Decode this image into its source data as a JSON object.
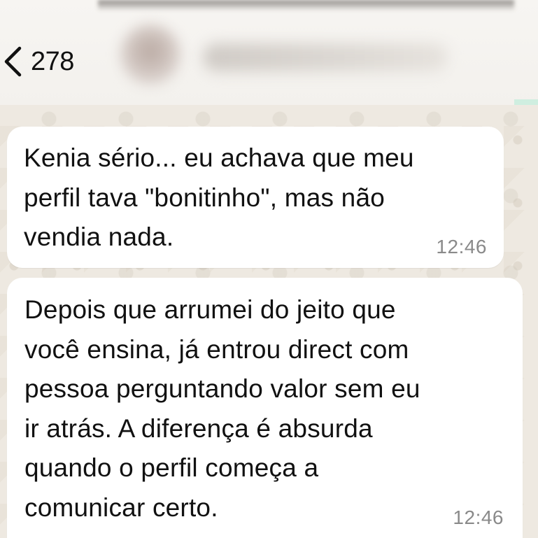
{
  "header": {
    "unread_count": "278",
    "back_icon": "chevron-left-icon"
  },
  "colors": {
    "chat_background": "#efeae2",
    "bubble_background": "#ffffff",
    "text": "#111111",
    "timestamp": "#8a8a8a"
  },
  "messages": [
    {
      "text": "Kenia sério... eu achava que meu\nperfil tava \"bonitinho\", mas não\nvendia nada.",
      "time": "12:46"
    },
    {
      "text": "Depois que arrumei do jeito que\nvocê ensina, já entrou direct com\npessoa perguntando valor sem eu\nir atrás. A diferença é absurda\nquando o perfil começa a\ncomunicar certo.",
      "time": "12:46"
    }
  ]
}
